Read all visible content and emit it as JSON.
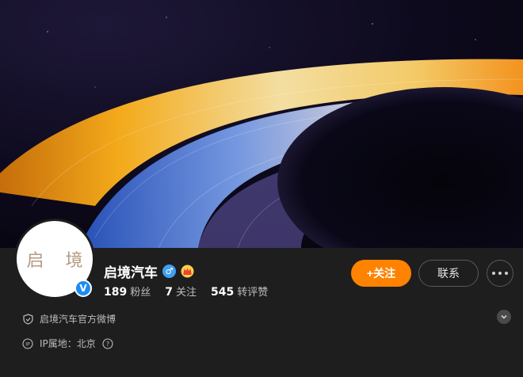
{
  "avatar": {
    "text": "启 境"
  },
  "profile": {
    "name": "启境汽车",
    "gender_symbol": "♂",
    "verified_symbol": "V"
  },
  "stats": [
    {
      "num": "189",
      "label": "粉丝"
    },
    {
      "num": "7",
      "label": "关注"
    },
    {
      "num": "545",
      "label": "转评赞"
    }
  ],
  "actions": {
    "follow_label": "+关注",
    "contact_label": "联系"
  },
  "info": {
    "bio": "启境汽车官方微博",
    "ip_location": "IP属地：北京"
  },
  "colors": {
    "accent": "#ff8200",
    "verified": "#1d8cf2"
  }
}
